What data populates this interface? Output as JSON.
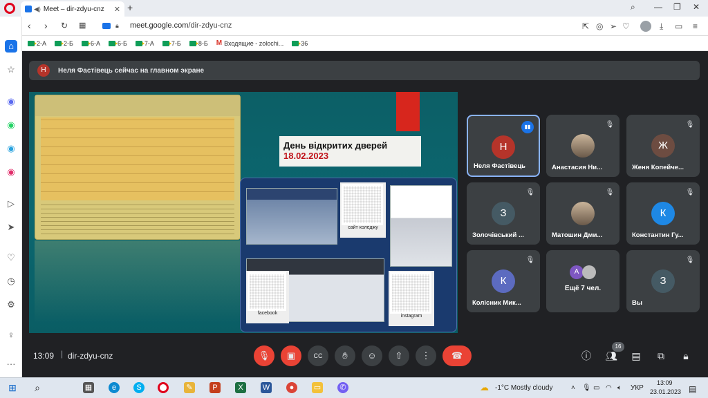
{
  "browser": {
    "tab_title": "Meet – dir-zdyu-cnz",
    "url_domain": "meet.google.com",
    "url_path": "/dir-zdyu-cnz",
    "bookmarks": [
      {
        "label": "2-А",
        "icon": "meet-icon"
      },
      {
        "label": "2-Б",
        "icon": "meet-icon"
      },
      {
        "label": "6-А",
        "icon": "meet-icon"
      },
      {
        "label": "6-Б",
        "icon": "meet-icon"
      },
      {
        "label": "7-А",
        "icon": "meet-icon"
      },
      {
        "label": "7-Б",
        "icon": "meet-icon"
      },
      {
        "label": "8-Б",
        "icon": "meet-icon"
      },
      {
        "label": "Входящие - zolochi...",
        "icon": "gmail-icon"
      },
      {
        "label": "36",
        "icon": "meet-icon"
      }
    ]
  },
  "meet": {
    "banner_initial": "Н",
    "banner_text": "Неля Фастівець сейчас на главном экране",
    "presentation": {
      "headline": "День відкритих дверей",
      "date": "18.02.2023",
      "qr_label_site": "сайт коледжу",
      "qr_label_facebook": "facebook",
      "qr_label_instagram": "instagram"
    },
    "participants": [
      {
        "initial": "Н",
        "name": "Неля Фастівець",
        "color": "#b5342a",
        "state": "speaking"
      },
      {
        "initial": "",
        "name": "Анастасия Ни...",
        "color": "#8d6e63",
        "state": "muted",
        "photo": true
      },
      {
        "initial": "Ж",
        "name": "Женя Копейче...",
        "color": "#6d4c41",
        "state": "muted"
      },
      {
        "initial": "З",
        "name": "Золочівський ...",
        "color": "#455a64",
        "state": "muted"
      },
      {
        "initial": "",
        "name": "Матошин Дми...",
        "color": "#9e9e9e",
        "state": "muted",
        "photo": true
      },
      {
        "initial": "К",
        "name": "Константин Гу...",
        "color": "#1e88e5",
        "state": "muted"
      },
      {
        "initial": "К",
        "name": "Колісник Мик...",
        "color": "#5c6bc0",
        "state": "muted"
      },
      {
        "initial": "A",
        "name": "Ещё 7 чел.",
        "color": "#7e57c2",
        "state": "more"
      },
      {
        "initial": "З",
        "name": "Вы",
        "color": "#455a64",
        "state": "muted"
      }
    ],
    "time": "13:09",
    "code": "dir-zdyu-cnz",
    "participant_count": "16"
  },
  "taskbar": {
    "weather": "-1°C  Mostly cloudy",
    "lang": "УКР",
    "clock_time": "13:09",
    "clock_date": "23.01.2023"
  },
  "colors": {
    "end_call": "#ea4335",
    "accent": "#1a73e8",
    "tile_bg": "#3c4043"
  }
}
